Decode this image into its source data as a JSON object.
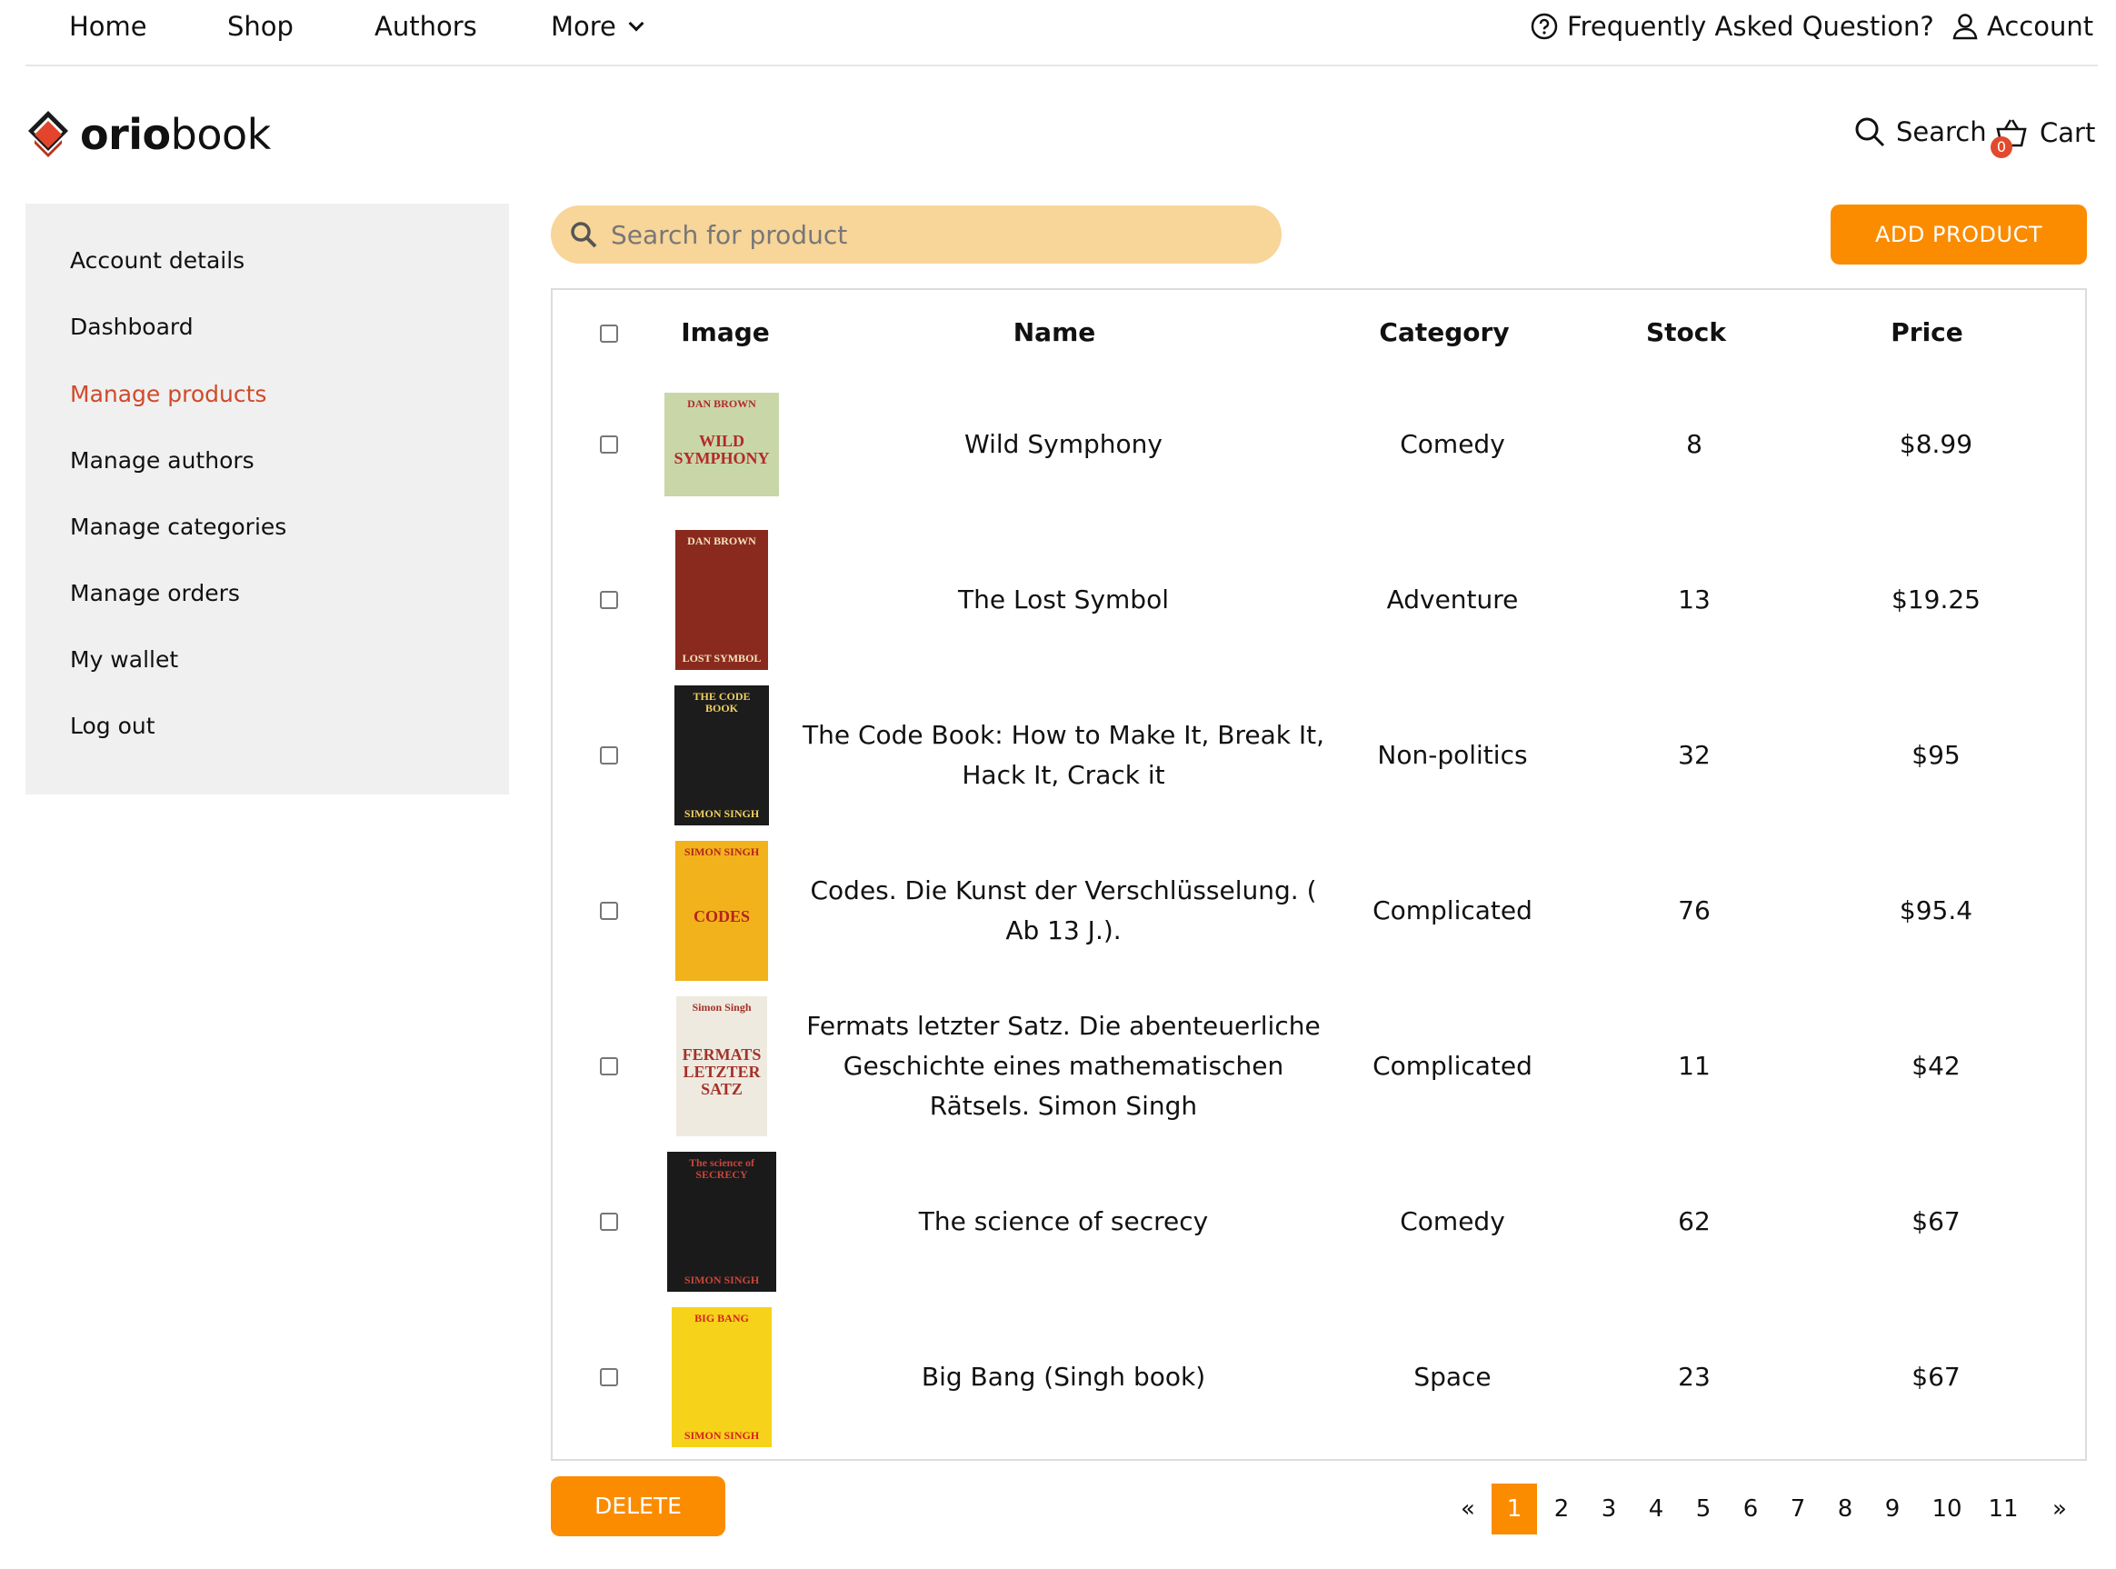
{
  "topnav": {
    "home": "Home",
    "shop": "Shop",
    "authors": "Authors",
    "more": "More",
    "faq": "Frequently Asked Question?",
    "account": "Account"
  },
  "brand": {
    "bold": "orio",
    "light": "book"
  },
  "header": {
    "search": "Search",
    "cart": "Cart",
    "cart_count": "0"
  },
  "sidebar": {
    "items": [
      {
        "label": "Account details"
      },
      {
        "label": "Dashboard"
      },
      {
        "label": "Manage products"
      },
      {
        "label": "Manage authors"
      },
      {
        "label": "Manage categories"
      },
      {
        "label": "Manage orders"
      },
      {
        "label": "My wallet"
      },
      {
        "label": "Log out"
      }
    ],
    "active_index": 2
  },
  "search": {
    "placeholder": "Search for product"
  },
  "actions": {
    "add_product": "ADD PRODUCT",
    "delete": "DELETE"
  },
  "table": {
    "headers": {
      "image": "Image",
      "name": "Name",
      "category": "Category",
      "stock": "Stock",
      "price": "Price"
    },
    "rows": [
      {
        "name": "Wild Symphony",
        "category": "Comedy",
        "stock": "8",
        "price": "$8.99",
        "cover": {
          "top": "DAN BROWN",
          "title": "WILD SYMPHONY",
          "bottom": "",
          "bg": "#c9d6a8",
          "fg": "#b22a2a"
        }
      },
      {
        "name": "The Lost Symbol",
        "category": "Adventure",
        "stock": "13",
        "price": "$19.25",
        "cover": {
          "top": "DAN BROWN",
          "title": "",
          "bottom": "LOST SYMBOL",
          "bg": "#8a2a1e",
          "fg": "#f3e2c0"
        }
      },
      {
        "name": "The Code Book: How to Make It, Break It, Hack It, Crack it",
        "category": "Non-politics",
        "stock": "32",
        "price": "$95",
        "cover": {
          "top": "THE CODE BOOK",
          "title": "",
          "bottom": "SIMON SINGH",
          "bg": "#1c1c1c",
          "fg": "#f0d060"
        }
      },
      {
        "name": "Codes. Die Kunst der Verschlüsselung. ( Ab 13 J.).",
        "category": "Complicated",
        "stock": "76",
        "price": "$95.4",
        "cover": {
          "top": "SIMON SINGH",
          "title": "CODES",
          "bottom": "",
          "bg": "#f2b21c",
          "fg": "#b3261e"
        }
      },
      {
        "name": "Fermats letzter Satz. Die abenteuerliche Geschichte eines mathematischen Rätsels. Simon Singh",
        "category": "Complicated",
        "stock": "11",
        "price": "$42",
        "cover": {
          "top": "Simon Singh",
          "title": "FERMATS LETZTER SATZ",
          "bottom": "",
          "bg": "#eeeadf",
          "fg": "#a3322a"
        }
      },
      {
        "name": "The science of secrecy",
        "category": "Comedy",
        "stock": "62",
        "price": "$67",
        "cover": {
          "top": "The science of SECRECY",
          "title": "",
          "bottom": "SIMON SINGH",
          "bg": "#1a1a1a",
          "fg": "#c8453a"
        }
      },
      {
        "name": "Big Bang (Singh book)",
        "category": "Space",
        "stock": "23",
        "price": "$67",
        "cover": {
          "top": "BIG BANG",
          "title": "",
          "bottom": "SIMON SINGH",
          "bg": "#f7d21a",
          "fg": "#d4221c"
        }
      }
    ]
  },
  "pagination": {
    "prev": "«",
    "next": "»",
    "pages": [
      "1",
      "2",
      "3",
      "4",
      "5",
      "6",
      "7",
      "8",
      "9",
      "10",
      "11"
    ],
    "current": "1"
  }
}
